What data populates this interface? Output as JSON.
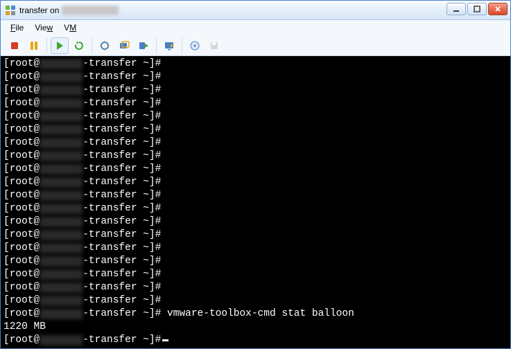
{
  "title": {
    "prefix": "transfer on",
    "hostname_redacted": true
  },
  "menu": {
    "file": "File",
    "view": "View",
    "vm": "VM"
  },
  "toolbar": {
    "stop": "Stop",
    "pause": "Pause",
    "play": "Play",
    "restart": "Restart",
    "snapshot": "Snapshot",
    "snapshot_manager": "Snapshot Manager",
    "revert": "Revert",
    "console": "Console",
    "cd": "CD/DVD",
    "floppy": "Floppy"
  },
  "terminal": {
    "prefix": "[root@",
    "suffix": "-transfer ~]#",
    "blank_line_count": 19,
    "command_line": {
      "command": "vmware-toolbox-cmd stat balloon"
    },
    "output": "1220 MB",
    "prompt_cursor": true
  }
}
